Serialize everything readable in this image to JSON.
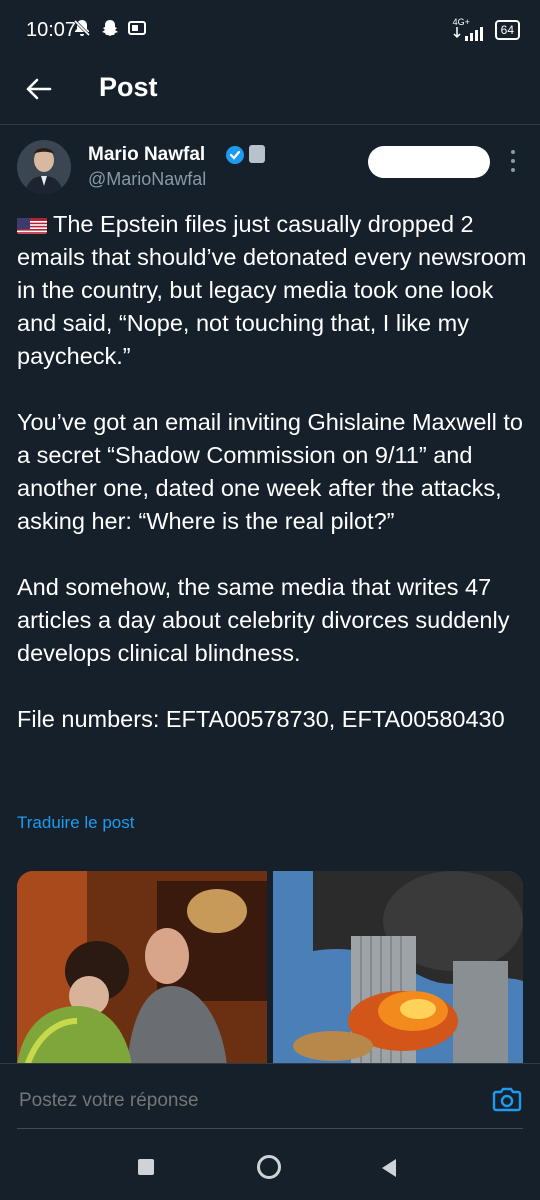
{
  "status_bar": {
    "time": "10:07",
    "network": "4G+",
    "battery": "64"
  },
  "header": {
    "title": "Post"
  },
  "post": {
    "author_name": "Mario Nawfal",
    "author_handle": "@MarioNawfal",
    "paragraphs": [
      "The Epstein files just casually dropped 2 emails that should’ve detonated every newsroom in the country, but legacy media took one look and said, “Nope, not touching that, I like my paycheck.”",
      "You’ve got an email inviting Ghislaine Maxwell to a secret “Shadow Commission on 9/11” and another one, dated one week after the attacks, asking her: “Where is the real pilot?”",
      "And somehow, the same media that writes 47 articles a day about celebrity divorces suddenly develops clinical blindness.",
      "File numbers: EFTA00578730, EFTA00580430"
    ],
    "translate_label": "Traduire le post"
  },
  "reply": {
    "placeholder": "Postez votre réponse"
  },
  "colors": {
    "background": "#15202b",
    "accent": "#1d9bf0",
    "secondary_text": "#8899a6",
    "divider": "#2f3b47"
  },
  "icons": {
    "back": "arrow-left-icon",
    "verified": "verified-badge-icon",
    "more": "more-vertical-icon",
    "camera": "camera-icon",
    "flag": "us-flag-icon"
  }
}
